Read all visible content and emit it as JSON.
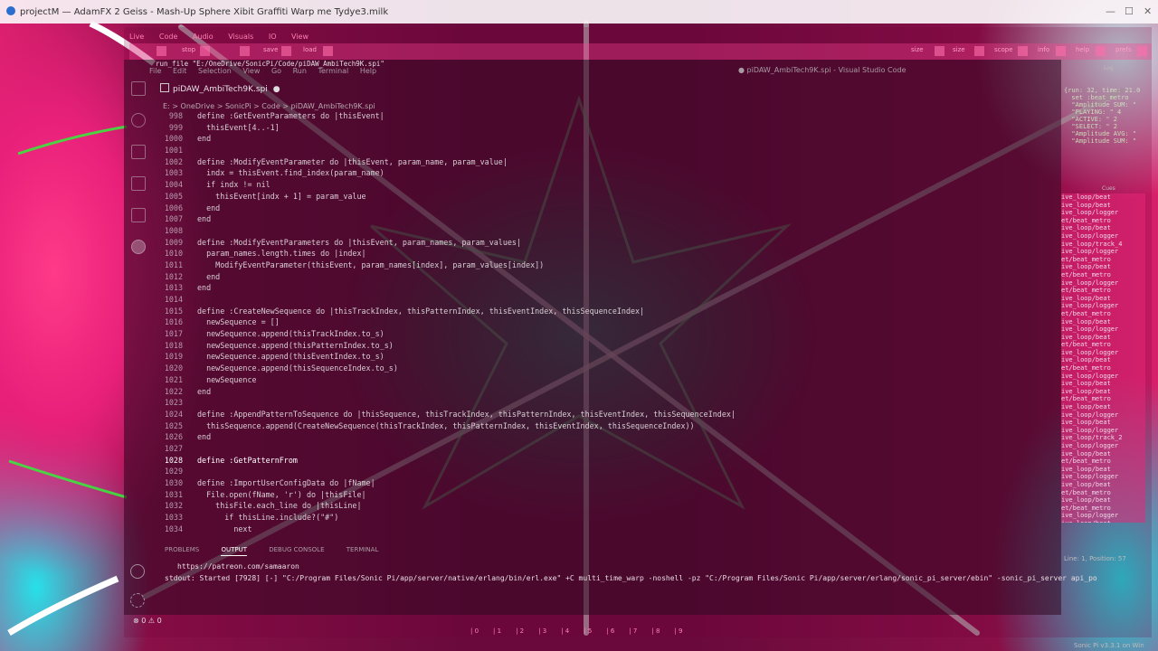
{
  "window": {
    "title": "projectM — AdamFX 2 Geiss - Mash-Up Sphere Xibit Graffiti Warp me Tydye3.milk"
  },
  "sonicpi": {
    "menu": [
      "Live",
      "Code",
      "Audio",
      "Visuals",
      "IO",
      "View"
    ],
    "toolbar": [
      "stop",
      "save",
      "load",
      "size",
      "size",
      "scope",
      "info",
      "help",
      "prefs"
    ],
    "path": "run_file \"E:/OneDrive/SonicPi/Code/piDAW_AmbiTech9K.spi\"",
    "version": "Sonic Pi v3.3.1 on Win",
    "cues_label": "Cues",
    "log_label": "Log",
    "status": "Line: 1, Position: 57",
    "bottom_buffers": [
      "0",
      "1",
      "2",
      "3",
      "4",
      "5",
      "6",
      "7",
      "8",
      "9"
    ],
    "log_top": [
      "{run: 32, time: 21.0",
      "  set :beat_metro",
      "  \"Amplitude SUM: \"",
      "  \"PLAYING: \" 4",
      "  \"ACTIVE: \" 2",
      "  \"SELECT: \" 2",
      "  \"Amplitude AVG: \"",
      "  \"Amplitude SUM: \""
    ],
    "cue_lines": [
      "ive_loop/beat",
      "ive_loop/beat",
      "ive_loop/logger",
      "et/beat_metro",
      "ive_loop/beat",
      "ive_loop/logger",
      "ive_loop/track_4",
      "ive_loop/logger",
      "et/beat_metro",
      "ive_loop/beat",
      "et/beat_metro",
      "ive_loop/logger",
      "et/beat_metro",
      "ive_loop/beat",
      "ive_loop/logger",
      "et/beat_metro",
      "ive_loop/beat",
      "ive_loop/logger",
      "ive_loop/beat",
      "et/beat_metro",
      "ive_loop/logger",
      "ive_loop/beat",
      "et/beat_metro",
      "ive_loop/logger",
      "ive_loop/beat",
      "ive_loop/beat",
      "et/beat_metro",
      "ive_loop/beat",
      "ive_loop/logger",
      "ive_loop/beat",
      "ive_loop/logger",
      "ive_loop/track_2",
      "ive_loop/logger",
      "ive_loop/beat",
      "et/beat_metro",
      "ive_loop/beat",
      "ive_loop/logger",
      "ive_loop/beat",
      "et/beat_metro",
      "ive_loop/beat",
      "et/beat_metro",
      "ive_loop/logger",
      "ive_loop/beat"
    ]
  },
  "vscode": {
    "menu": [
      "File",
      "Edit",
      "Selection",
      "View",
      "Go",
      "Run",
      "Terminal",
      "Help"
    ],
    "title": "● piDAW_AmbiTech9K.spi - Visual Studio Code",
    "tab": "piDAW_AmbiTech9K.spi",
    "tab_dot": "●",
    "breadcrumb": "E: > OneDrive > SonicPi > Code > piDAW_AmbiTech9K.spi",
    "code_lines": [
      {
        "n": "998",
        "t": "define :GetEventParameters do |thisEvent|"
      },
      {
        "n": "999",
        "t": "  thisEvent[4..-1]"
      },
      {
        "n": "1000",
        "t": "end"
      },
      {
        "n": "1001",
        "t": ""
      },
      {
        "n": "1002",
        "t": "define :ModifyEventParameter do |thisEvent, param_name, param_value|"
      },
      {
        "n": "1003",
        "t": "  indx = thisEvent.find_index(param_name)"
      },
      {
        "n": "1004",
        "t": "  if indx != nil"
      },
      {
        "n": "1005",
        "t": "    thisEvent[indx + 1] = param_value"
      },
      {
        "n": "1006",
        "t": "  end"
      },
      {
        "n": "1007",
        "t": "end"
      },
      {
        "n": "1008",
        "t": ""
      },
      {
        "n": "1009",
        "t": "define :ModifyEventParameters do |thisEvent, param_names, param_values|"
      },
      {
        "n": "1010",
        "t": "  param_names.length.times do |index|"
      },
      {
        "n": "1011",
        "t": "    ModifyEventParameter(thisEvent, param_names[index], param_values[index])"
      },
      {
        "n": "1012",
        "t": "  end"
      },
      {
        "n": "1013",
        "t": "end"
      },
      {
        "n": "1014",
        "t": ""
      },
      {
        "n": "1015",
        "t": "define :CreateNewSequence do |thisTrackIndex, thisPatternIndex, thisEventIndex, thisSequenceIndex|"
      },
      {
        "n": "1016",
        "t": "  newSequence = []"
      },
      {
        "n": "1017",
        "t": "  newSequence.append(thisTrackIndex.to_s)"
      },
      {
        "n": "1018",
        "t": "  newSequence.append(thisPatternIndex.to_s)"
      },
      {
        "n": "1019",
        "t": "  newSequence.append(thisEventIndex.to_s)"
      },
      {
        "n": "1020",
        "t": "  newSequence.append(thisSequenceIndex.to_s)"
      },
      {
        "n": "1021",
        "t": "  newSequence"
      },
      {
        "n": "1022",
        "t": "end"
      },
      {
        "n": "1023",
        "t": ""
      },
      {
        "n": "1024",
        "t": "define :AppendPatternToSequence do |thisSequence, thisTrackIndex, thisPatternIndex, thisEventIndex, thisSequenceIndex|"
      },
      {
        "n": "1025",
        "t": "  thisSequence.append(CreateNewSequence(thisTrackIndex, thisPatternIndex, thisEventIndex, thisSequenceIndex))"
      },
      {
        "n": "1026",
        "t": "end"
      },
      {
        "n": "1027",
        "t": ""
      },
      {
        "n": "1028",
        "t": "define :GetPatternFrom"
      },
      {
        "n": "1029",
        "t": ""
      },
      {
        "n": "1030",
        "t": "define :ImportUserConfigData do |fName|"
      },
      {
        "n": "1031",
        "t": "  File.open(fName, 'r') do |thisFile|"
      },
      {
        "n": "1032",
        "t": "    thisFile.each_line do |thisLine|"
      },
      {
        "n": "1033",
        "t": "      if thisLine.include?(\"#\")"
      },
      {
        "n": "1034",
        "t": "        next"
      }
    ],
    "panel_tabs": [
      "PROBLEMS",
      "OUTPUT",
      "DEBUG CONSOLE",
      "TERMINAL"
    ],
    "output_lines": [
      "https://patreon.com/samaaron",
      "stdout: Started [7928] [-] \"C:/Program Files/Sonic Pi/app/server/native/erlang/bin/erl.exe\" +C multi_time_warp -noshell -pz \"C:/Program Files/Sonic Pi/app/server/erlang/sonic_pi_server/ebin\" -sonic_pi_server api_po"
    ],
    "status": {
      "errors": "0",
      "warnings": "0"
    }
  }
}
